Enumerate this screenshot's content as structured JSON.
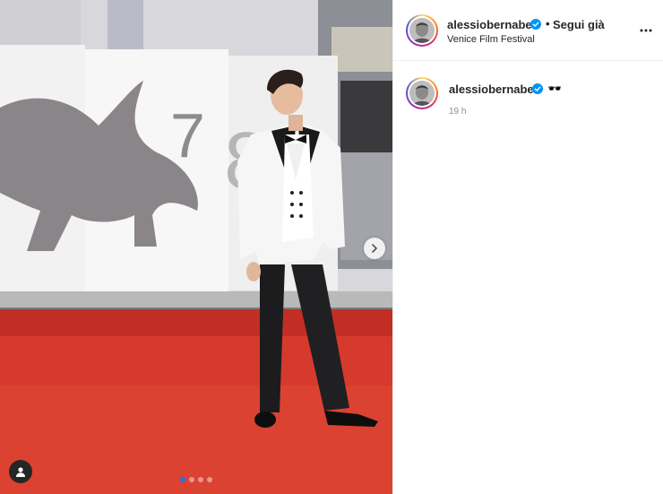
{
  "post": {
    "username": "alessiobernabei",
    "follow_separator": "•",
    "follow_label": "Segui già",
    "location": "Venice Film Festival",
    "caption_emoji": "🕶️",
    "time_ago": "19 h",
    "carousel": {
      "total_slides": 4,
      "active_slide": 1
    }
  },
  "icons": {
    "verified": "verified-badge-icon",
    "more": "more-options-icon",
    "next": "chevron-right-icon",
    "user_tag": "user-tag-icon"
  },
  "colors": {
    "verified_blue": "#0095f6",
    "carpet_red": "#d63a2c",
    "text_primary": "#262626",
    "text_secondary": "#8e8e8e"
  }
}
